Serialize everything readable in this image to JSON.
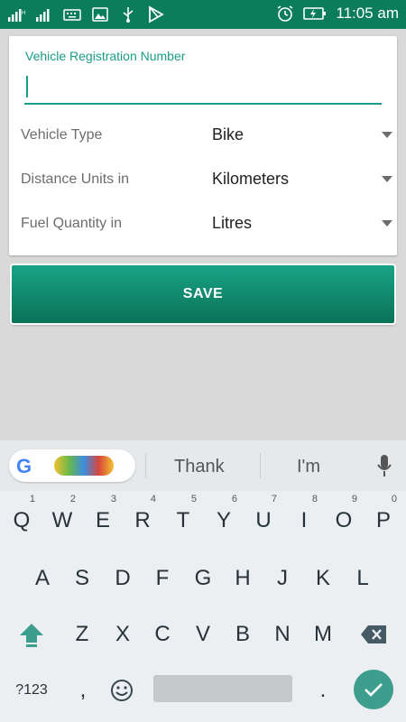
{
  "status_bar": {
    "time": "11:05 am",
    "icons": [
      "signal-icon",
      "signal-icon",
      "keyboard-icon",
      "image-icon",
      "usb-icon",
      "play-store-icon",
      "alarm-icon",
      "battery-charging-icon"
    ]
  },
  "form": {
    "registration_label": "Vehicle Registration Number",
    "registration_value": "",
    "vehicle_type_label": "Vehicle Type",
    "vehicle_type_value": "Bike",
    "distance_units_label": "Distance Units in",
    "distance_units_value": "Kilometers",
    "fuel_quantity_label": "Fuel Quantity in",
    "fuel_quantity_value": "Litres"
  },
  "save_button": {
    "label": "SAVE"
  },
  "keyboard": {
    "suggestions": [
      "Thank",
      "I'm"
    ],
    "row1": [
      {
        "k": "Q",
        "hint": "1"
      },
      {
        "k": "W",
        "hint": "2"
      },
      {
        "k": "E",
        "hint": "3"
      },
      {
        "k": "R",
        "hint": "4"
      },
      {
        "k": "T",
        "hint": "5"
      },
      {
        "k": "Y",
        "hint": "6"
      },
      {
        "k": "U",
        "hint": "7"
      },
      {
        "k": "I",
        "hint": "8"
      },
      {
        "k": "O",
        "hint": "9"
      },
      {
        "k": "P",
        "hint": "0"
      }
    ],
    "row2": [
      "A",
      "S",
      "D",
      "F",
      "G",
      "H",
      "J",
      "K",
      "L"
    ],
    "row3": [
      "Z",
      "X",
      "C",
      "V",
      "B",
      "N",
      "M"
    ],
    "symbols_key": "?123",
    "comma_key": ",",
    "period_key": "."
  },
  "colors": {
    "accent": "#1a9c86",
    "status_bar": "#0b7d5b",
    "button_top": "#19a386",
    "button_bottom": "#0a7258",
    "enter_key": "#3e9e8d"
  }
}
